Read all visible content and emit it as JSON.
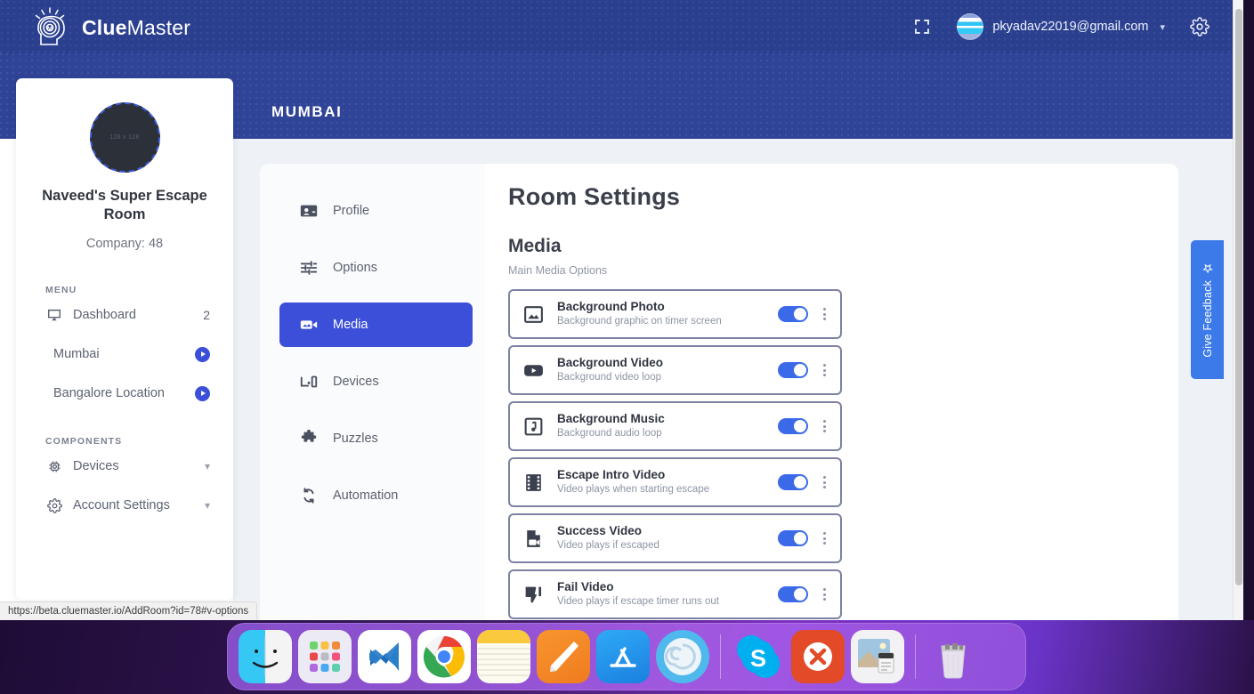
{
  "app": {
    "brand_bold": "Clue",
    "brand_light": "Master",
    "logo_icon": "brain-head-icon",
    "fullscreen_icon": "fullscreen-icon",
    "account_email": "pkyadav22019@gmail.com",
    "account_chevron_icon": "chevron-down-icon",
    "settings_icon": "gear-icon",
    "avatar_icon": "user-avatar"
  },
  "banner": {
    "title": "MUMBAI"
  },
  "sidebar": {
    "avatar_placeholder": "128 x 128",
    "room_name": "Naveed's Super Escape Room",
    "company": "Company: 48",
    "menu_label": "MENU",
    "components_label": "COMPONENTS",
    "menu_items": [
      {
        "label": "Dashboard",
        "icon": "monitor-icon",
        "badge": "2",
        "trailing": "badge"
      },
      {
        "label": "Mumbai",
        "icon": "none",
        "badge": "",
        "trailing": "play"
      },
      {
        "label": "Bangalore Location",
        "icon": "none",
        "badge": "",
        "trailing": "play"
      }
    ],
    "component_items": [
      {
        "label": "Devices",
        "icon": "chip-icon",
        "trailing": "chevron"
      },
      {
        "label": "Account Settings",
        "icon": "gear-icon",
        "trailing": "chevron"
      }
    ]
  },
  "subnav": {
    "items": [
      {
        "label": "Profile",
        "icon": "contact-card-icon",
        "active": false
      },
      {
        "label": "Options",
        "icon": "sliders-icon",
        "active": false
      },
      {
        "label": "Media",
        "icon": "video-camera-icon",
        "active": true
      },
      {
        "label": "Devices",
        "icon": "device-icon",
        "active": false
      },
      {
        "label": "Puzzles",
        "icon": "puzzle-piece-icon",
        "active": false
      },
      {
        "label": "Automation",
        "icon": "sync-icon",
        "active": false
      }
    ]
  },
  "main": {
    "page_title": "Room Settings",
    "section_title": "Media",
    "section_subtitle": "Main Media Options",
    "cards": [
      {
        "title": "Background Photo",
        "desc": "Background graphic on timer screen",
        "icon": "photo-icon",
        "toggle": "on"
      },
      {
        "title": "Background Video",
        "desc": "Background video loop",
        "icon": "youtube-play-icon",
        "toggle": "on"
      },
      {
        "title": "Background Music",
        "desc": "Background audio loop",
        "icon": "music-note-icon",
        "toggle": "on"
      },
      {
        "title": "Escape Intro Video",
        "desc": "Video plays when starting escape",
        "icon": "film-strip-icon",
        "toggle": "on"
      },
      {
        "title": "Success Video",
        "desc": "Video plays if escaped",
        "icon": "video-file-icon",
        "toggle": "on"
      },
      {
        "title": "Fail Video",
        "desc": "Video plays if escape timer runs out",
        "icon": "thumbs-down-icon",
        "toggle": "on"
      }
    ]
  },
  "feedback": {
    "label": "Give Feedback",
    "icon": "star-plus-icon"
  },
  "status": {
    "url": "https://beta.cluemaster.io/AddRoom?id=78#v-options"
  },
  "dock": {
    "apps": [
      {
        "name": "finder",
        "running": true
      },
      {
        "name": "launchpad",
        "running": false
      },
      {
        "name": "vscode",
        "running": false
      },
      {
        "name": "chrome",
        "running": true
      },
      {
        "name": "notes",
        "running": false
      },
      {
        "name": "pages",
        "running": false
      },
      {
        "name": "app-store",
        "running": false
      },
      {
        "name": "snail",
        "running": false
      },
      {
        "name": "skype",
        "running": true
      },
      {
        "name": "remote-desktop",
        "running": true
      },
      {
        "name": "preview",
        "running": false
      },
      {
        "name": "trash",
        "running": false
      }
    ]
  },
  "colors": {
    "brand_blue": "#2b3f8f",
    "banner_blue": "#2f4397",
    "accent": "#3b4fd8",
    "toggle_on": "#3b6ae8",
    "card_border": "#7c82a3",
    "content_bg": "#eef1f5"
  }
}
